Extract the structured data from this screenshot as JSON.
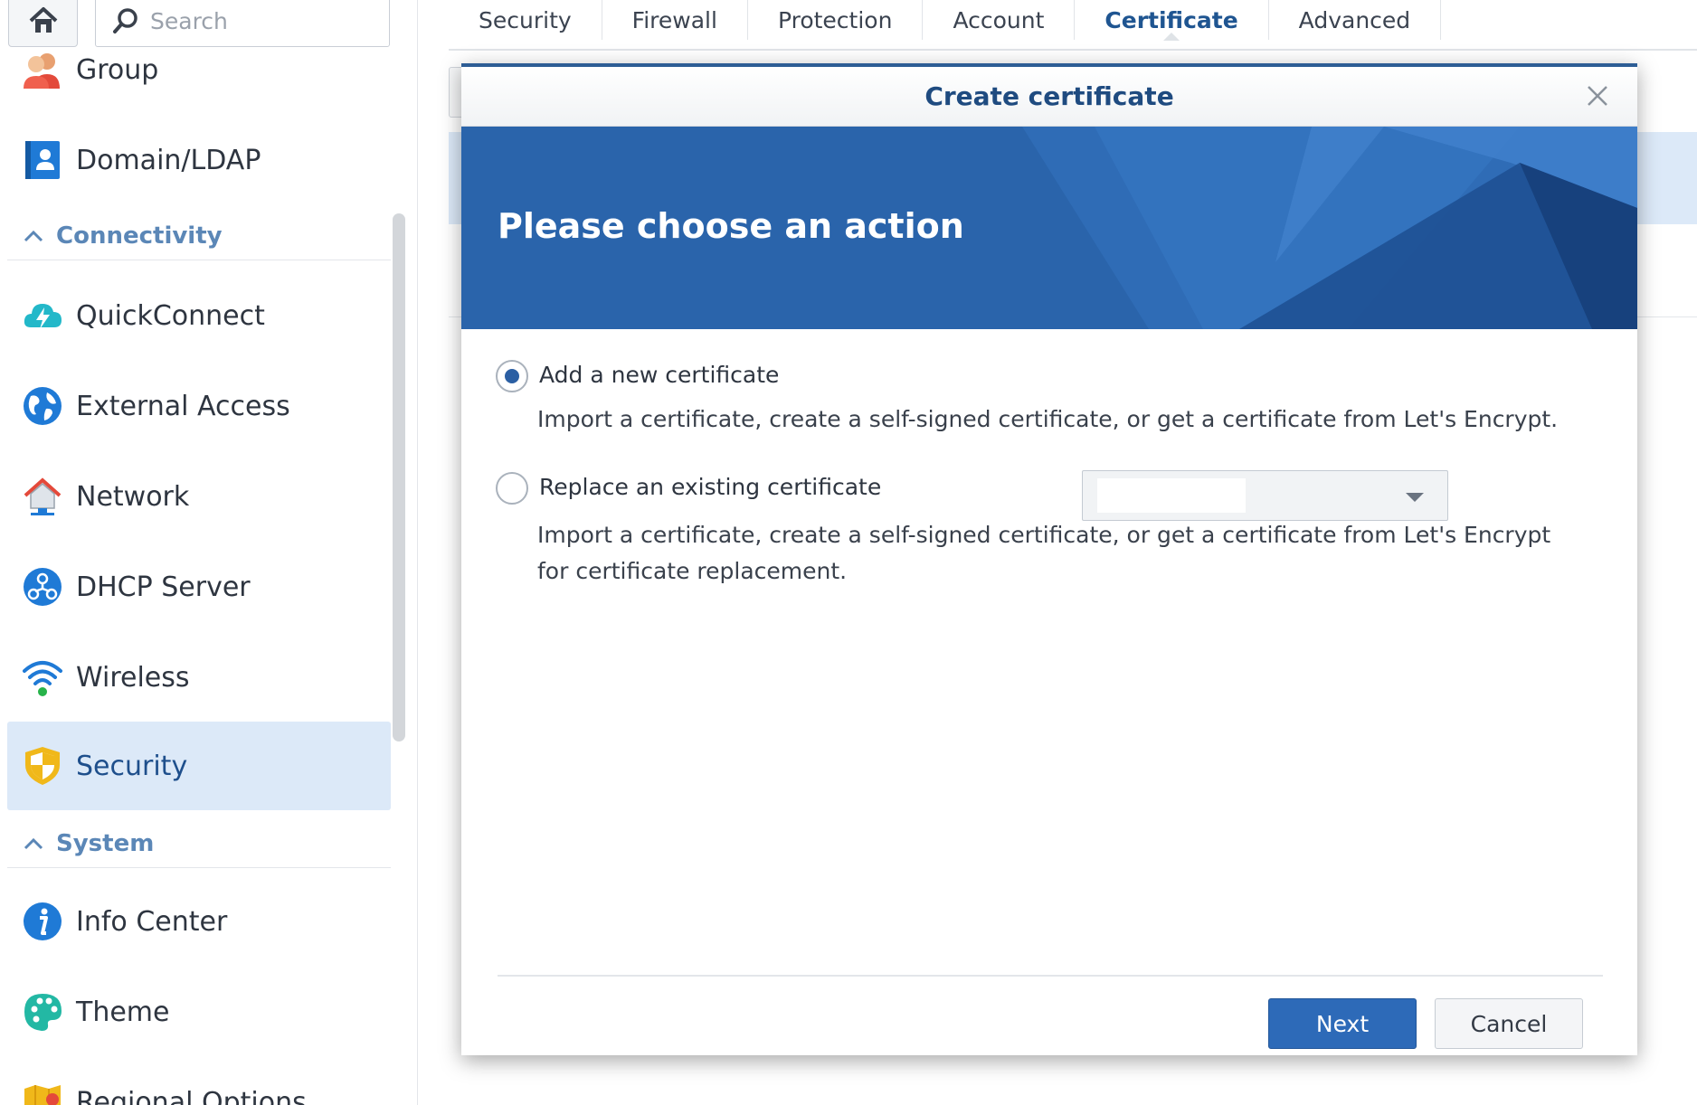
{
  "sidebar": {
    "search_placeholder": "Search",
    "items_top": [
      {
        "label": "Group",
        "icon": "group-icon"
      },
      {
        "label": "Domain/LDAP",
        "icon": "domain-ldap-icon"
      }
    ],
    "sections": [
      {
        "label": "Connectivity"
      },
      {
        "label": "System"
      }
    ],
    "connectivity_items": [
      {
        "label": "QuickConnect",
        "icon": "quickconnect-icon"
      },
      {
        "label": "External Access",
        "icon": "globe-icon"
      },
      {
        "label": "Network",
        "icon": "house-network-icon"
      },
      {
        "label": "DHCP Server",
        "icon": "dhcp-icon"
      },
      {
        "label": "Wireless",
        "icon": "wifi-icon"
      },
      {
        "label": "Security",
        "icon": "shield-icon",
        "active": true
      }
    ],
    "system_items": [
      {
        "label": "Info Center",
        "icon": "info-icon"
      },
      {
        "label": "Theme",
        "icon": "palette-icon"
      },
      {
        "label": "Regional Options",
        "icon": "map-icon"
      }
    ]
  },
  "tabs": [
    {
      "label": "Security"
    },
    {
      "label": "Firewall"
    },
    {
      "label": "Protection"
    },
    {
      "label": "Account"
    },
    {
      "label": "Certificate",
      "active": true
    },
    {
      "label": "Advanced"
    }
  ],
  "modal": {
    "title": "Create certificate",
    "banner_title": "Please choose an action",
    "options": [
      {
        "label": "Add a new certificate",
        "desc": "Import a certificate, create a self-signed certificate, or get a certificate from Let's Encrypt.",
        "checked": true
      },
      {
        "label": "Replace an existing certificate",
        "desc": "Import a certificate, create a self-signed certificate, or get a certificate from Let's Encrypt for certificate replacement.",
        "checked": false
      }
    ],
    "next_label": "Next",
    "cancel_label": "Cancel"
  },
  "colors": {
    "accent": "#2d6ab8",
    "banner": "#2a64ab",
    "section_header": "#5b87b7",
    "active_bg": "#dce9f8"
  }
}
